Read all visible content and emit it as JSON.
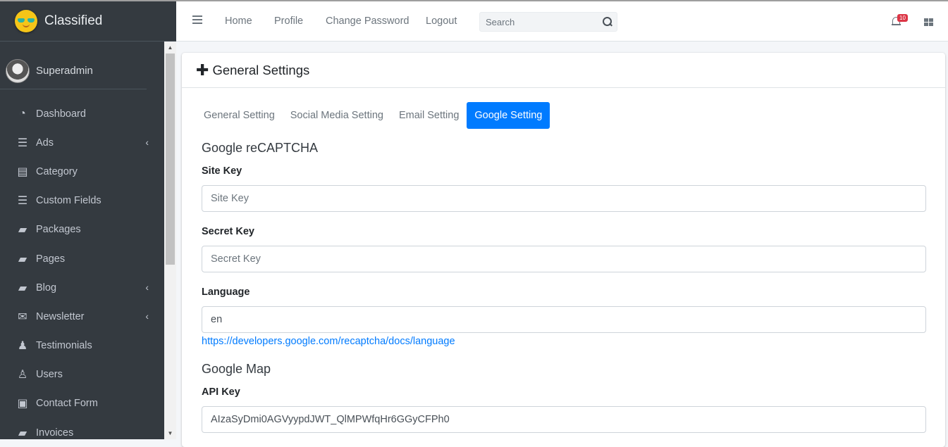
{
  "brand": {
    "name": "Classified"
  },
  "user": {
    "name": "Superadmin"
  },
  "sidebar": {
    "items": [
      {
        "label": "Dashboard",
        "icon": "dashboard-icon",
        "arrow": false
      },
      {
        "label": "Ads",
        "icon": "bars-icon",
        "arrow": true
      },
      {
        "label": "Category",
        "icon": "list-icon",
        "arrow": false
      },
      {
        "label": "Custom Fields",
        "icon": "bars-icon",
        "arrow": false
      },
      {
        "label": "Packages",
        "icon": "book-icon",
        "arrow": false
      },
      {
        "label": "Pages",
        "icon": "book-icon",
        "arrow": false
      },
      {
        "label": "Blog",
        "icon": "book-icon",
        "arrow": true
      },
      {
        "label": "Newsletter",
        "icon": "envelope-icon",
        "arrow": true
      },
      {
        "label": "Testimonials",
        "icon": "users-icon",
        "arrow": false
      },
      {
        "label": "Users",
        "icon": "user-icon",
        "arrow": false
      },
      {
        "label": "Contact Form",
        "icon": "id-card-icon",
        "arrow": false
      },
      {
        "label": "Invoices",
        "icon": "book-icon",
        "arrow": false
      }
    ]
  },
  "navbar": {
    "home": "Home",
    "profile": "Profile",
    "change_password": "Change Password",
    "logout": "Logout",
    "search_placeholder": "Search",
    "notifications_count": "10"
  },
  "page": {
    "title": "General Settings",
    "tabs": [
      "General Setting",
      "Social Media Setting",
      "Email Setting",
      "Google Setting"
    ],
    "active_tab": "Google Setting"
  },
  "recaptcha": {
    "title": "Google reCAPTCHA",
    "site_key_label": "Site Key",
    "site_key_placeholder": "Site Key",
    "site_key_value": "",
    "secret_key_label": "Secret Key",
    "secret_key_placeholder": "Secret Key",
    "secret_key_value": "",
    "language_label": "Language",
    "language_value": "en",
    "language_link": "https://developers.google.com/recaptcha/docs/language"
  },
  "map": {
    "title": "Google Map",
    "api_key_label": "API Key",
    "api_key_value": "AIzaSyDmi0AGVyypdJWT_QlMPWfqHr6GGyCFPh0"
  },
  "colors": {
    "sidebar_bg": "#343a40",
    "accent": "#007bff",
    "badge": "#dc3545"
  }
}
